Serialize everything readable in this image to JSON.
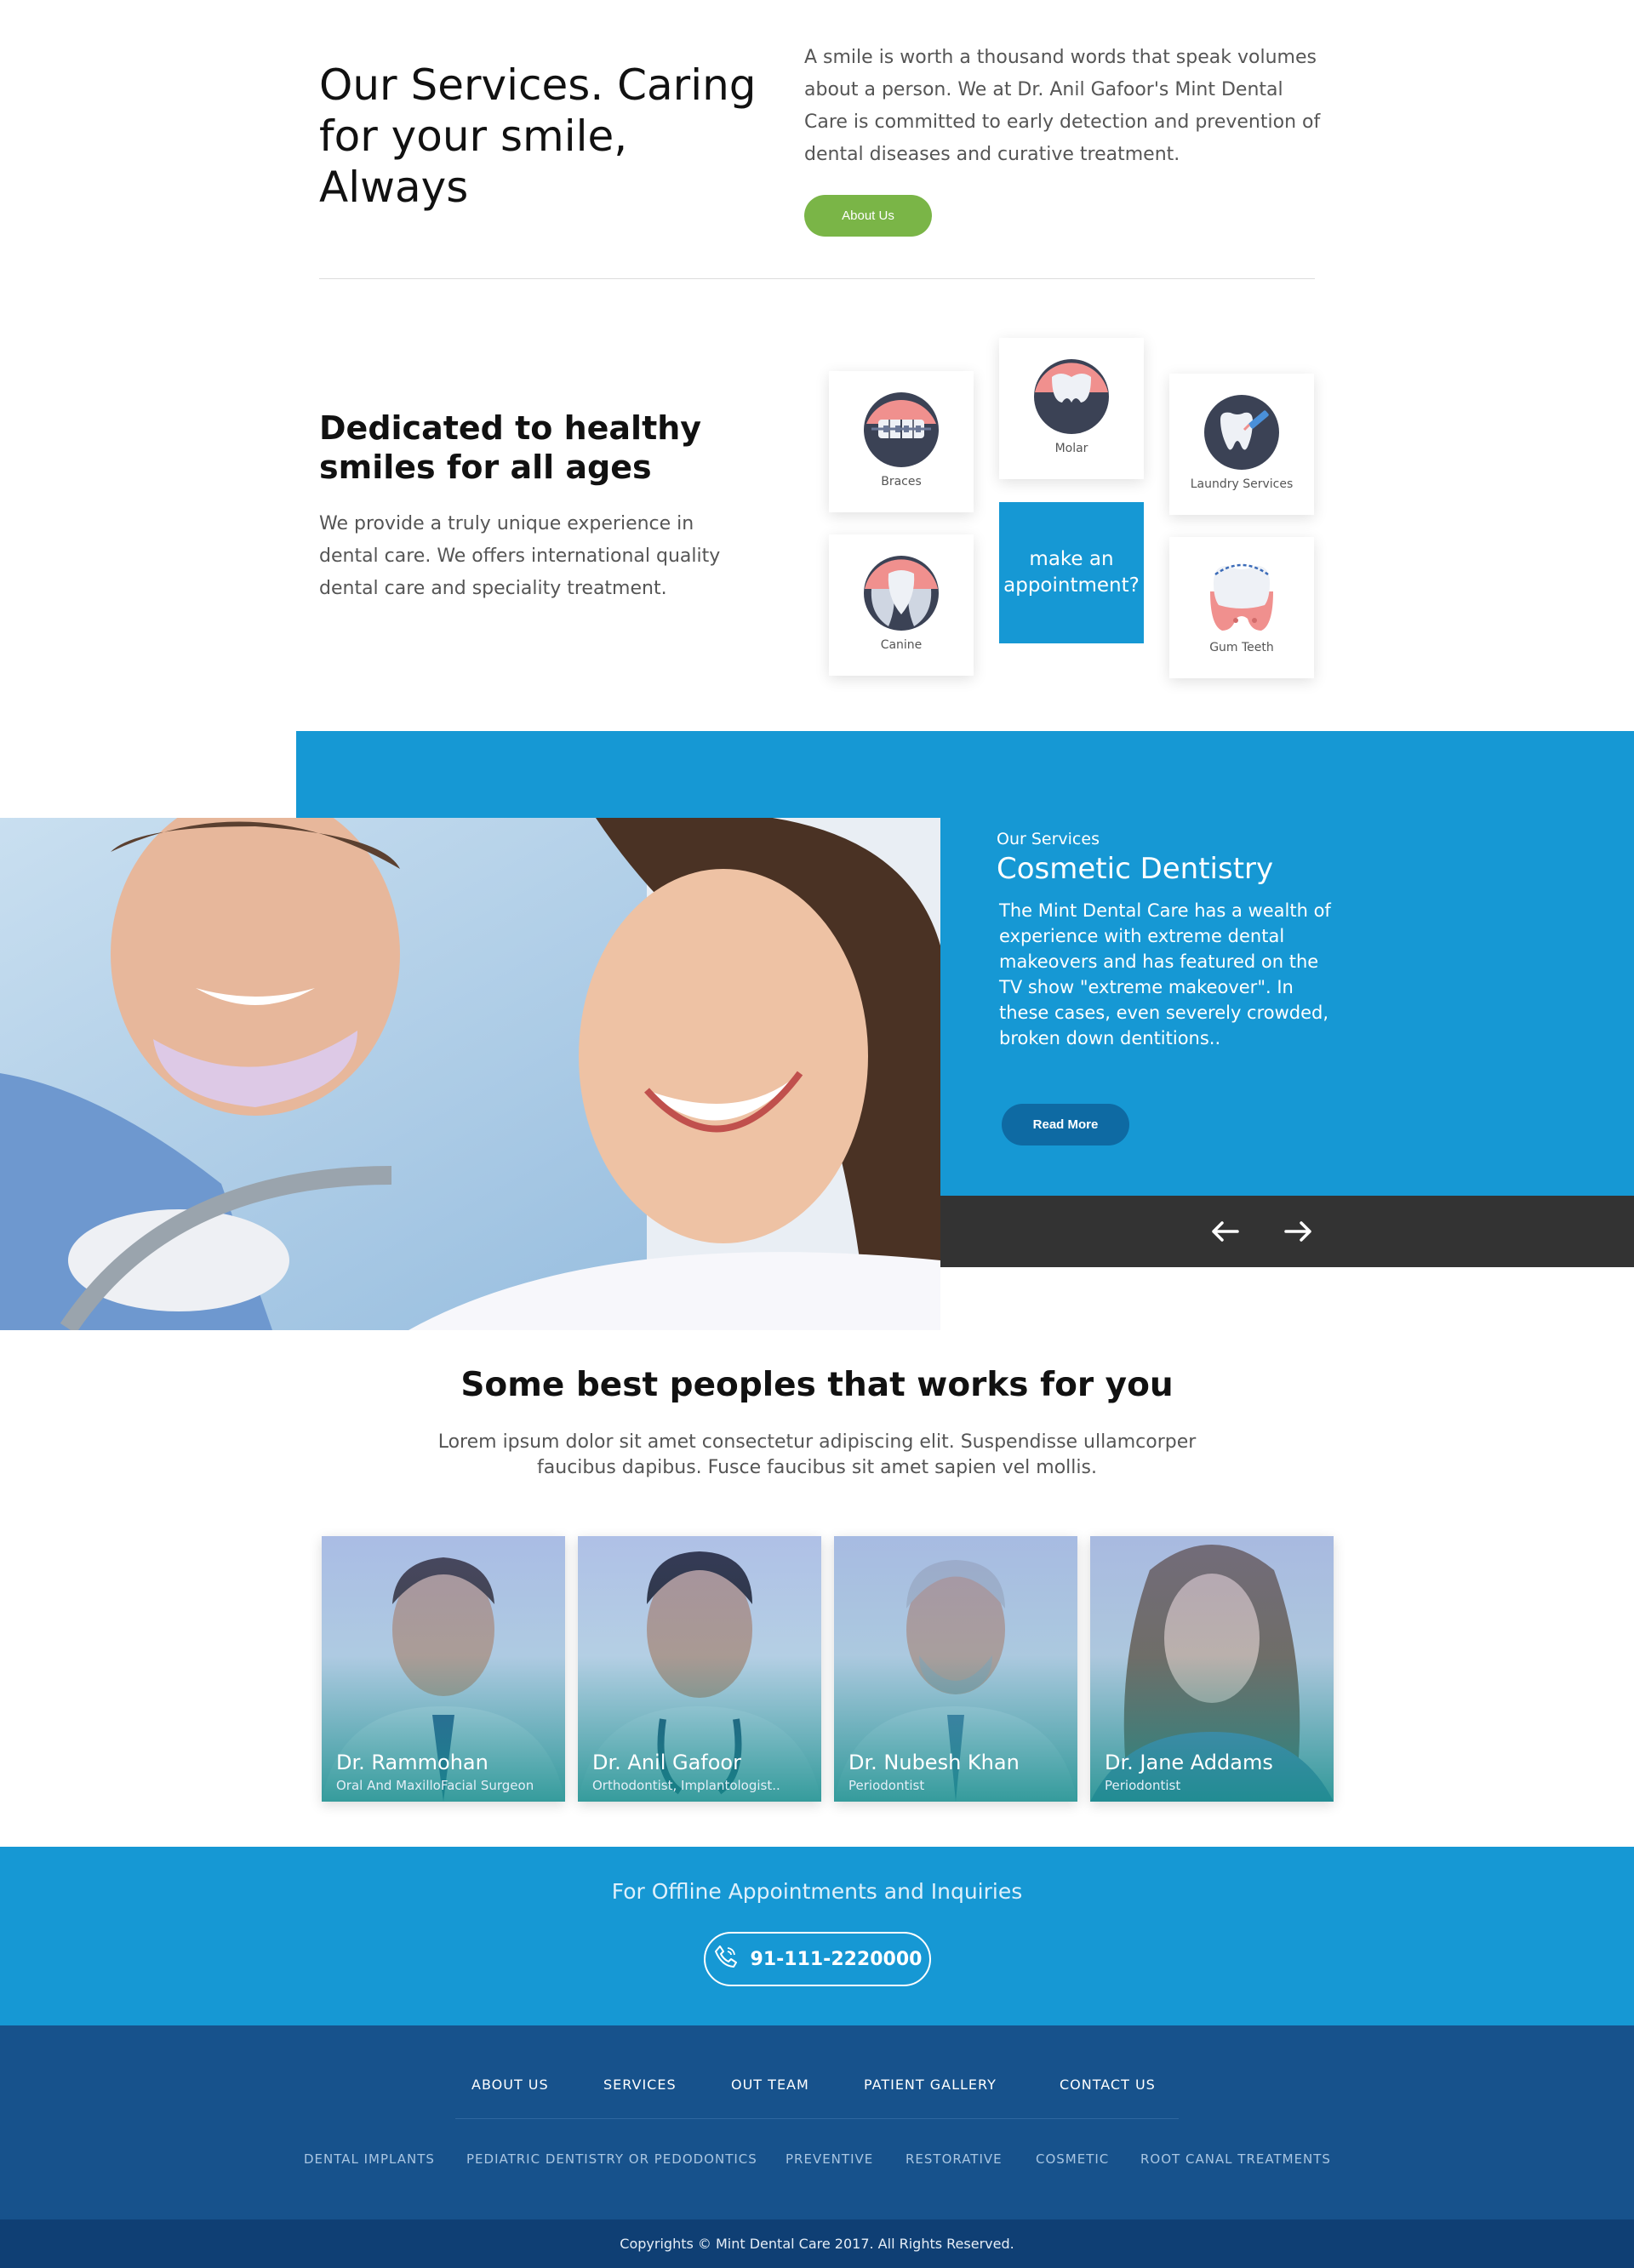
{
  "intro": {
    "title": "Our Services. Caring for your smile, Always",
    "text": "A smile is worth a thousand words that speak volumes about a person. We at Dr. Anil Gafoor's Mint Dental Care is committed to early detection and prevention of dental diseases and curative treatment.",
    "about_label": "About Us"
  },
  "dedicated": {
    "title": "Dedicated to healthy smiles for all ages",
    "text": "We provide a truly unique experience in dental care. We offers international quality dental care and speciality treatment."
  },
  "services": {
    "braces": "Braces",
    "molar": "Molar",
    "laundry": "Laundry Services",
    "canine": "Canine",
    "gum": "Gum Teeth",
    "appointment": "make an appointment?"
  },
  "hero": {
    "subtitle": "Our Services",
    "title": "Cosmetic Dentistry",
    "text": "The Mint Dental Care has a wealth of experience with extreme dental makeovers and has featured on the TV show \"extreme makeover\". In these cases, even severely crowded, broken down dentitions..",
    "read_more": "Read More"
  },
  "team": {
    "title": "Some best peoples that works for you",
    "text": "Lorem ipsum dolor sit amet consectetur adipiscing elit. Suspendisse ullamcorper faucibus dapibus. Fusce faucibus sit amet sapien vel mollis.",
    "members": [
      {
        "name": "Dr. Rammohan",
        "role": "Oral And MaxilloFacial Surgeon"
      },
      {
        "name": "Dr. Anil Gafoor",
        "role": "Orthodontist, Implantologist.."
      },
      {
        "name": "Dr. Nubesh Khan",
        "role": "Periodontist"
      },
      {
        "name": "Dr. Jane Addams",
        "role": "Periodontist"
      }
    ]
  },
  "contact": {
    "label": "For  Offline Appointments and Inquiries",
    "phone": "91-111-2220000"
  },
  "footer": {
    "nav": [
      "ABOUT US",
      "SERVICES",
      "OUT TEAM",
      "PATIENT GALLERY",
      "CONTACT US"
    ],
    "sub": [
      "DENTAL IMPLANTS",
      "PEDIATRIC DENTISTRY OR PEDODONTICS",
      "PREVENTIVE",
      "RESTORATIVE",
      "COSMETIC",
      "ROOT CANAL TREATMENTS"
    ],
    "copyright": "Copyrights © Mint Dental Care 2017. All Rights Reserved."
  },
  "colors": {
    "green": "#7ab547",
    "blue": "#1698d4",
    "dark_blue": "#17528c",
    "navy": "#0f3f74",
    "dark_bar": "#333333"
  }
}
